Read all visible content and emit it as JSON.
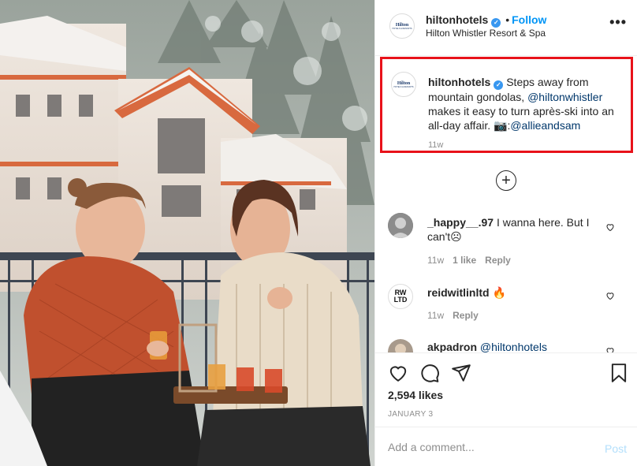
{
  "header": {
    "username": "hiltonhotels",
    "separator": "•",
    "follow_label": "Follow",
    "location": "Hilton Whistler Resort & Spa",
    "more_label": "•••",
    "avatar_logo": {
      "top": "Hilton",
      "bottom": "HOTELS & RESORTS"
    }
  },
  "caption": {
    "username": "hiltonhotels",
    "text_before": "Steps away from mountain gondolas, ",
    "mention": "@hiltonwhistler",
    "text_after": " makes it easy to turn après-ski into an all-day affair. 📷:",
    "credit": "@allieandsam",
    "time": "11w",
    "highlight_color": "#e8121a"
  },
  "load_more_label": "+",
  "comments": [
    {
      "username": "_happy__.97",
      "text": "I wanna here. But I can't☹",
      "time": "11w",
      "likes": "1 like",
      "reply": "Reply",
      "avatar_icon": "user-photo-icon"
    },
    {
      "username": "reidwitlinltd",
      "text": "🔥",
      "time": "11w",
      "reply": "Reply",
      "avatar_label": "RW\nLTD"
    },
    {
      "username": "akpadron",
      "text": "@hiltonhotels",
      "avatar_icon": "user-photo-icon"
    }
  ],
  "actions": {
    "icons": [
      "heart-icon",
      "comment-icon",
      "share-icon",
      "save-icon"
    ],
    "likes": "2,594 likes",
    "date": "JANUARY 3"
  },
  "add_comment": {
    "placeholder": "Add a comment...",
    "post_label": "Post"
  },
  "colors": {
    "accent": "#0095f6",
    "verified": "#3897f0",
    "muted": "#8e8e8e"
  }
}
